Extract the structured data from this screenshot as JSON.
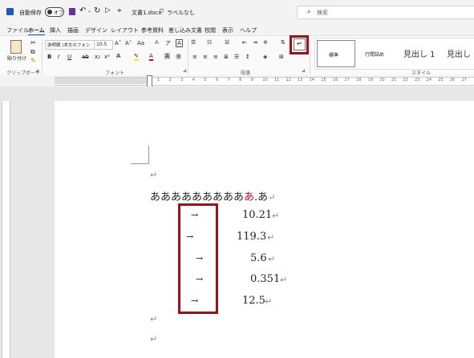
{
  "titlebar": {
    "autosave_label": "自動保存",
    "autosave_state": "オフ",
    "filename": "文書1.docx",
    "sensitivity": "ラベルなし",
    "search_placeholder": "検索"
  },
  "menu": {
    "tabs": [
      "ファイル",
      "ホーム",
      "挿入",
      "描画",
      "デザイン",
      "レイアウト",
      "参考資料",
      "差し込み文書",
      "校閲",
      "表示",
      "ヘルプ"
    ],
    "active_tab": "ホーム"
  },
  "ribbon": {
    "paste_label": "貼り付け",
    "font_name": "游明朝 (本文のフォン",
    "font_size": "10.5",
    "groups": {
      "clipboard": "クリップボード",
      "font": "フォント",
      "paragraph": "段落",
      "styles": "スタイル"
    },
    "styles": [
      "標準",
      "行間詰め",
      "見出し 1",
      "見出し"
    ]
  },
  "ruler": {
    "ticks": [
      "1",
      "2",
      "3",
      "4",
      "5",
      "6",
      "7",
      "8",
      "9",
      "10",
      "11",
      "12",
      "13",
      "14",
      "15",
      "16",
      "17",
      "18",
      "19",
      "20",
      "21",
      "22",
      "23",
      "24",
      "25",
      "26",
      "27"
    ]
  },
  "document": {
    "line1_text": "あああああああああ",
    "line1_red": "あ",
    "line1_tail": ".あ",
    "tab_arrow": "→",
    "values": [
      "10.21",
      "119.3",
      "5.6",
      "0.351",
      "12.5"
    ],
    "para_mark": "↵"
  },
  "colors": {
    "highlight_red": "#a10f18",
    "accent": "#185abd"
  }
}
